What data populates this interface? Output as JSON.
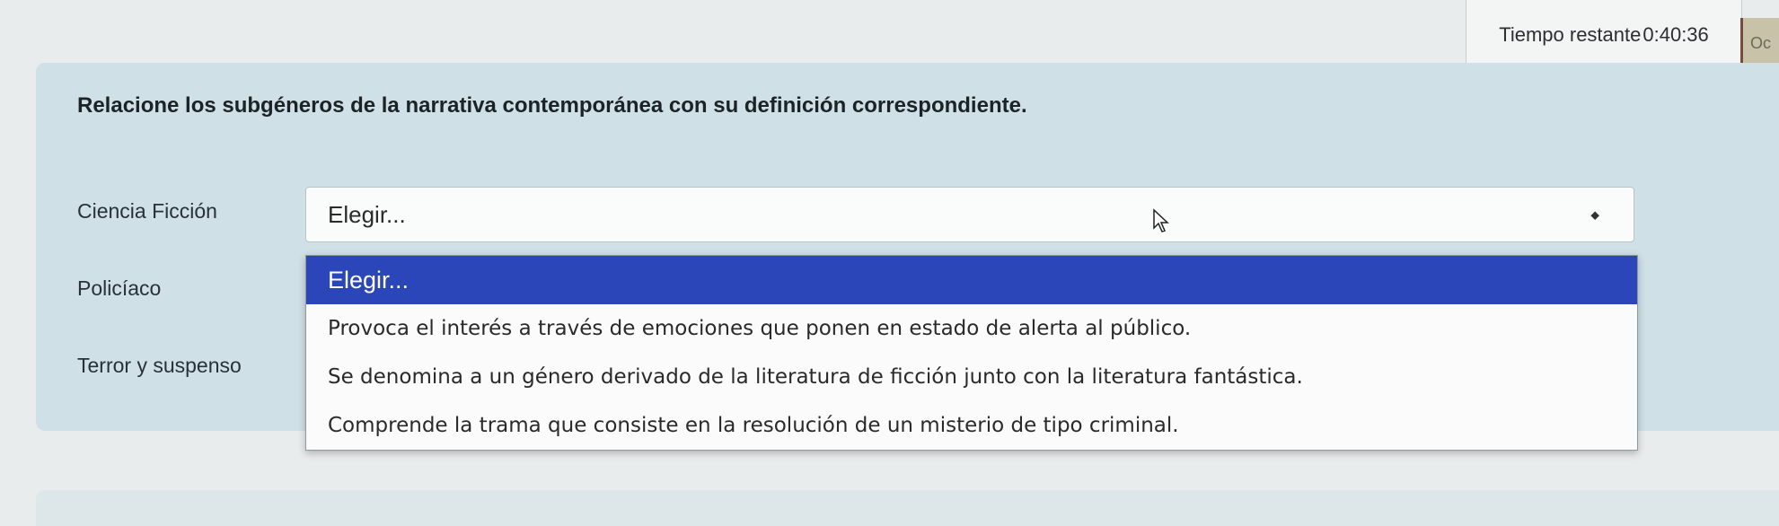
{
  "timer": {
    "label": "Tiempo restante",
    "value": "0:40:36"
  },
  "hide_button": {
    "label": "Oc"
  },
  "question": {
    "text": "Relacione los subgéneros de la narrativa contemporánea con su definición correspondiente.",
    "rows": [
      {
        "label": "Ciencia Ficción"
      },
      {
        "label": "Policíaco"
      },
      {
        "label": "Terror y suspenso"
      }
    ],
    "select": {
      "value": "Elegir..."
    },
    "dropdown_options": [
      "Elegir...",
      "Provoca el interés a través de emociones que ponen en estado de alerta al público.",
      "Se denomina a un género derivado de la literatura de ficción junto con la literatura fantástica.",
      "Comprende la trama que consiste en la resolución de un misterio de tipo criminal."
    ]
  },
  "colors": {
    "accent": "#2a46b8",
    "card_bg": "#cfe0e6",
    "page_bg": "#e9ecec"
  },
  "icons": {
    "select_caret": "caret-icon",
    "cursor": "mouse-cursor-icon"
  }
}
